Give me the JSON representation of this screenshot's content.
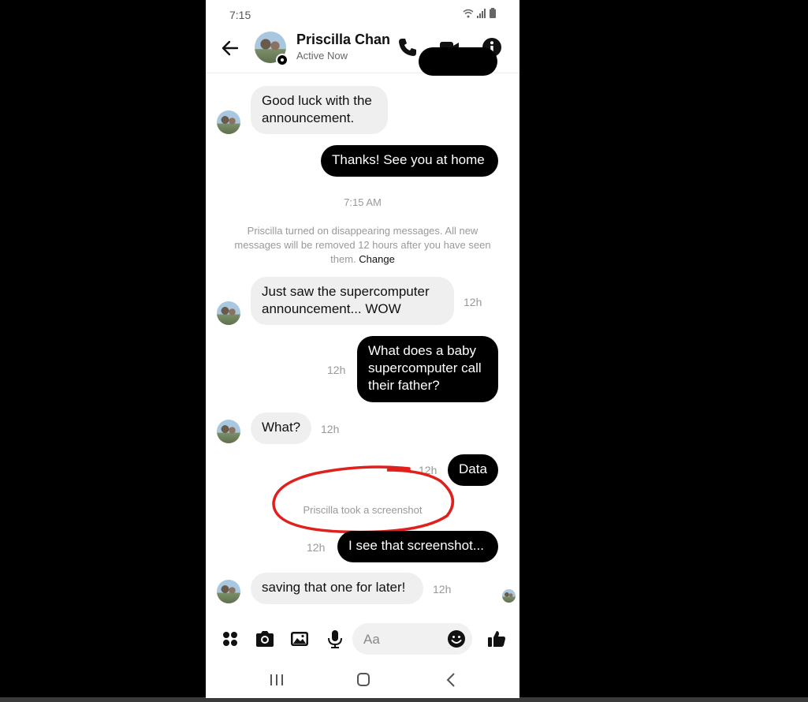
{
  "status_bar": {
    "time": "7:15"
  },
  "header": {
    "name": "Priscilla Chan",
    "status": "Active Now"
  },
  "messages": {
    "m1": "Good luck with the announcement.",
    "m2": "Thanks! See you at home",
    "divider_time": "7:15 AM",
    "notice_text": "Priscilla turned on disappearing messages. All new messages will be removed 12 hours after you have seen them.",
    "notice_link": "Change",
    "m3": "Just saw the supercomputer announcement... WOW",
    "m3_time": "12h",
    "m4": "What does a baby supercomputer call their father?",
    "m4_time": "12h",
    "m5": "What?",
    "m5_time": "12h",
    "m6": "Data",
    "m6_time": "12h",
    "screenshot_notice": "Priscilla took a screenshot",
    "m7": "I see that screenshot...",
    "m7_time": "12h",
    "m8": "saving that one for later!",
    "m8_time": "12h"
  },
  "composer": {
    "placeholder": "Aa"
  },
  "icons": {
    "back": "back-arrow-icon",
    "call": "phone-icon",
    "video": "video-camera-icon",
    "info": "info-icon",
    "apps": "four-dots-icon",
    "camera": "camera-icon",
    "gallery": "image-icon",
    "mic": "microphone-icon",
    "emoji": "emoji-icon",
    "like": "thumbs-up-icon"
  },
  "colors": {
    "outgoing_bubble": "#000000",
    "incoming_bubble": "#efefef",
    "annotation": "#e0201c"
  }
}
